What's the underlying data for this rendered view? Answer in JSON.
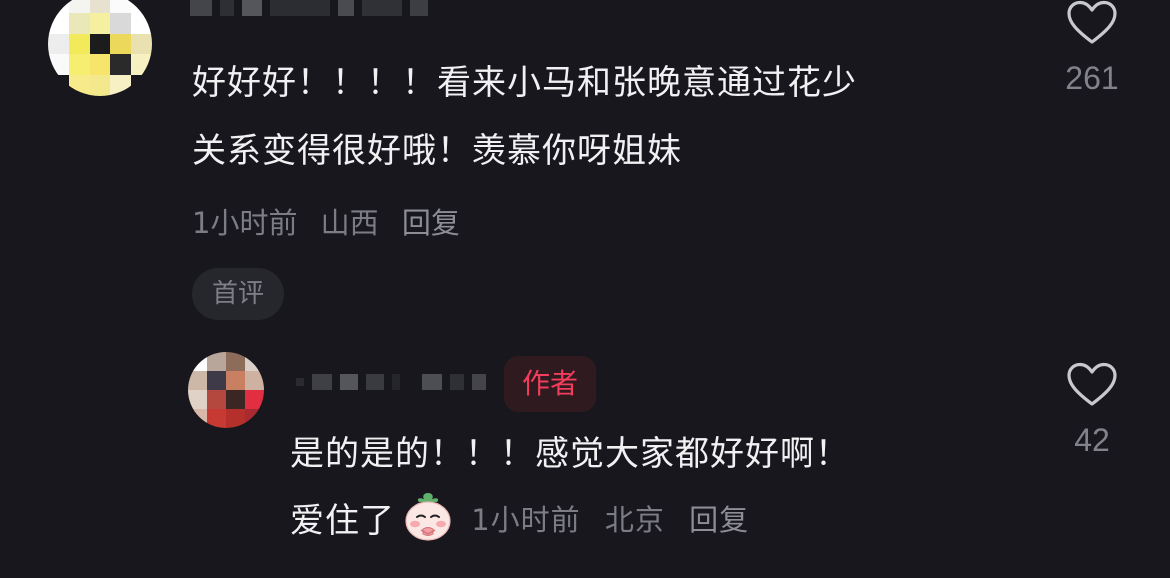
{
  "comment": {
    "text_line1": "好好好！！！！看来小马和张晚意通过花少",
    "text_line2": "关系变得很好哦！羡慕你呀姐妹",
    "time": "1小时前",
    "location": "山西",
    "reply_label": "回复",
    "first_tag": "首评",
    "like_count": "261",
    "avatar_pixels": [
      "#ffffff",
      "#f4f4f0",
      "#e6e2cf",
      "#fbfbfb",
      "#ffffff",
      "#ffffff",
      "#eae7b9",
      "#f5f0a0",
      "#d9d9d9",
      "#ffffff",
      "#ededed",
      "#f2ea5a",
      "#1c1c1c",
      "#ecd85a",
      "#e9e2b0",
      "#fafafa",
      "#f5ee70",
      "#f6e56a",
      "#2a2a2a",
      "#f7f1c2",
      "#17171d",
      "#f7ea8a",
      "#f3e98c",
      "#f6f0c4",
      "#17171d"
    ]
  },
  "reply": {
    "author_tag": "作者",
    "text_line1": "是的是的！！！感觉大家都好好啊！",
    "text_line2": "爱住了",
    "sticker": "shy-face-emoji-icon",
    "time": "1小时前",
    "location": "北京",
    "reply_label": "回复",
    "like_count": "42",
    "avatar_pixels": [
      "#ffffff",
      "#b9a69a",
      "#8d6c5a",
      "#d8cfc8",
      "#cdb8a8",
      "#3e3a48",
      "#c97f62",
      "#cfb1a1",
      "#e1d2c8",
      "#b5483e",
      "#3a2622",
      "#e12e40",
      "#d9b7a9",
      "#c63a33",
      "#b5302a",
      "#a92a30"
    ]
  },
  "colors": {
    "background": "#17171d",
    "author_accent": "#f23d5c",
    "muted_text": "#7c7c85"
  }
}
